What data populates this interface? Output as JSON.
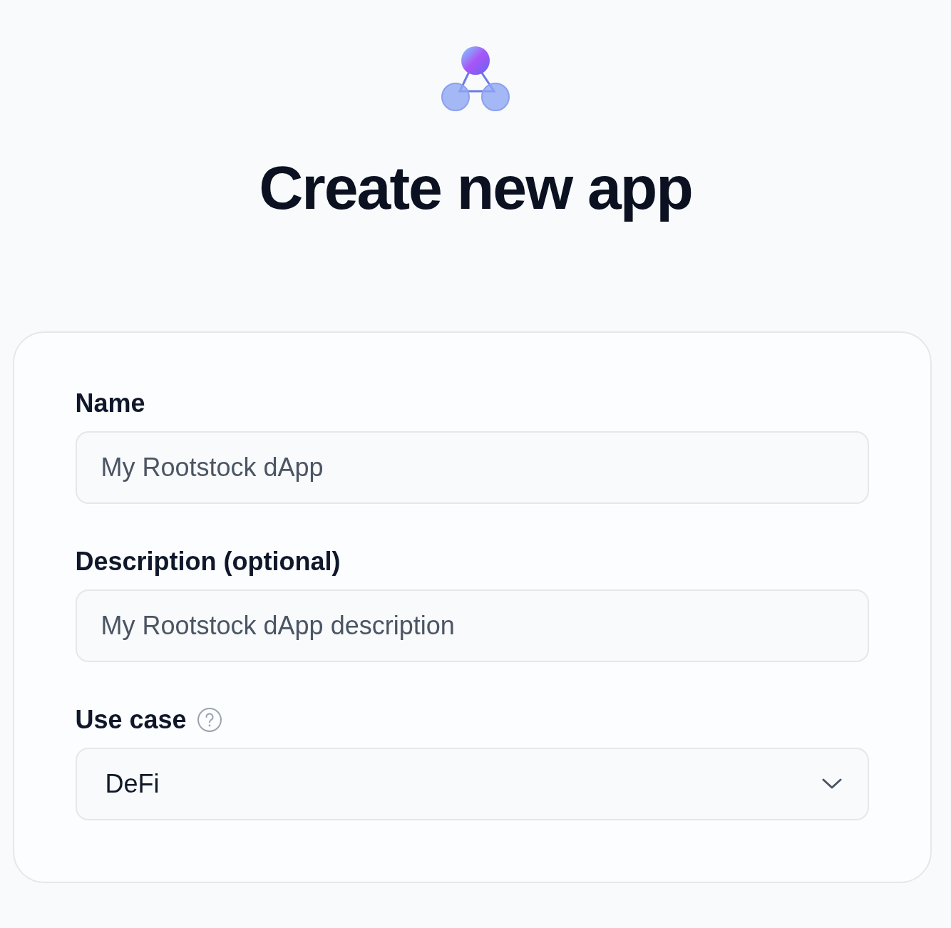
{
  "title": "Create new app",
  "form": {
    "fields": [
      {
        "kind": "text",
        "label": "Name",
        "placeholder": "My Rootstock dApp"
      },
      {
        "kind": "text",
        "label": "Description (optional)",
        "placeholder": "My Rootstock dApp description"
      },
      {
        "kind": "select",
        "label": "Use case",
        "value": "DeFi",
        "help": true
      }
    ]
  }
}
